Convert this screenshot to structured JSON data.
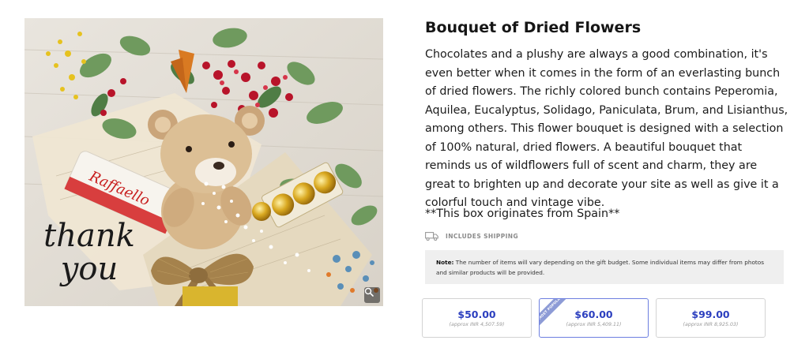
{
  "product": {
    "title": "Bouquet of Dried Flowers",
    "description": "Chocolates and a plushy are always a good combination, it's even better when it comes in the form of an everlasting bunch of dried flowers. The richly colored bunch contains Peperomia, Aquilea, Eucalyptus, Solidago, Paniculata, Brum, and Lisianthus, among others. This flower bouquet is designed with a selection of 100% natural, dried flowers. A beautiful bouquet that reminds us of wildflowers full of scent and charm, they are great to brighten up and decorate your site as well as give it a colorful touch and vintage vibe.",
    "origin": "**This box originates from Spain**"
  },
  "image": {
    "thank_line1": "thank",
    "thank_line2": "you",
    "chocolate_label": "Raffaello",
    "icons": [
      "zoom-icon"
    ]
  },
  "shipping": {
    "label": "INCLUDES SHIPPING",
    "icon": "truck-icon"
  },
  "note": {
    "label": "Note:",
    "text": " The number of items will vary depending on the gift budget. Some individual items may differ from photos and similar products will be provided."
  },
  "prices": [
    {
      "amount": "$50.00",
      "approx": "(approx INR 4,507.59)",
      "selected": false
    },
    {
      "amount": "$60.00",
      "approx": "(approx INR 5,409.11)",
      "selected": true,
      "badge": "MOST POPULAR"
    },
    {
      "amount": "$99.00",
      "approx": "(approx INR 8,925.03)",
      "selected": false
    }
  ],
  "colors": {
    "price": "#2c3fbf",
    "selected_border": "#6d7fe0",
    "note_bg": "#efefef"
  }
}
